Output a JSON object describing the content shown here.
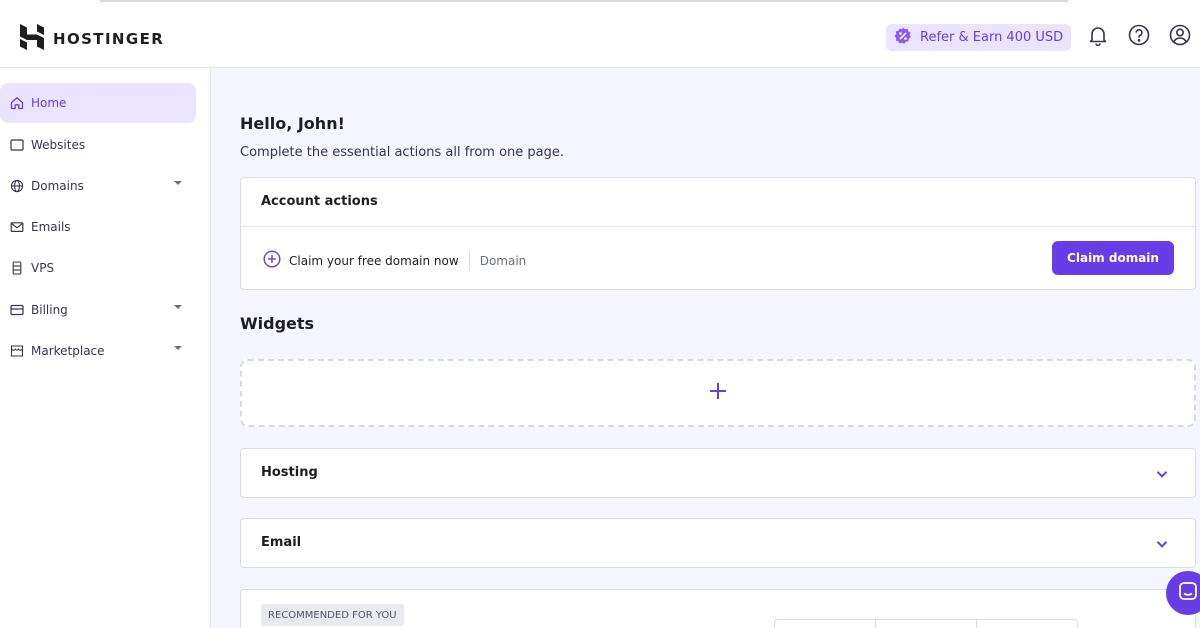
{
  "brand": {
    "name": "HOSTINGER"
  },
  "header": {
    "refer_label": "Refer & Earn 400 USD",
    "icons": [
      "bell-icon",
      "help-icon",
      "user-icon"
    ]
  },
  "sidebar": {
    "items": [
      {
        "label": "Home",
        "icon": "home-icon",
        "active": true,
        "expandable": false
      },
      {
        "label": "Websites",
        "icon": "window-icon",
        "active": false,
        "expandable": false
      },
      {
        "label": "Domains",
        "icon": "globe-icon",
        "active": false,
        "expandable": true
      },
      {
        "label": "Emails",
        "icon": "mail-icon",
        "active": false,
        "expandable": false
      },
      {
        "label": "VPS",
        "icon": "server-icon",
        "active": false,
        "expandable": false
      },
      {
        "label": "Billing",
        "icon": "card-icon",
        "active": false,
        "expandable": true
      },
      {
        "label": "Marketplace",
        "icon": "store-icon",
        "active": false,
        "expandable": true
      }
    ]
  },
  "main": {
    "greeting": "Hello, John!",
    "subtitle": "Complete the essential actions all from one page.",
    "account_actions": {
      "title": "Account actions",
      "action_text": "Claim your free domain now",
      "action_tag": "Domain",
      "button_label": "Claim domain"
    },
    "widgets_title": "Widgets",
    "sections": [
      {
        "title": "Hosting"
      },
      {
        "title": "Email"
      }
    ],
    "recommended_badge": "RECOMMENDED FOR YOU"
  },
  "colors": {
    "accent": "#673de6",
    "accent_light": "#ebe4ff",
    "text": "#1d1e20"
  }
}
